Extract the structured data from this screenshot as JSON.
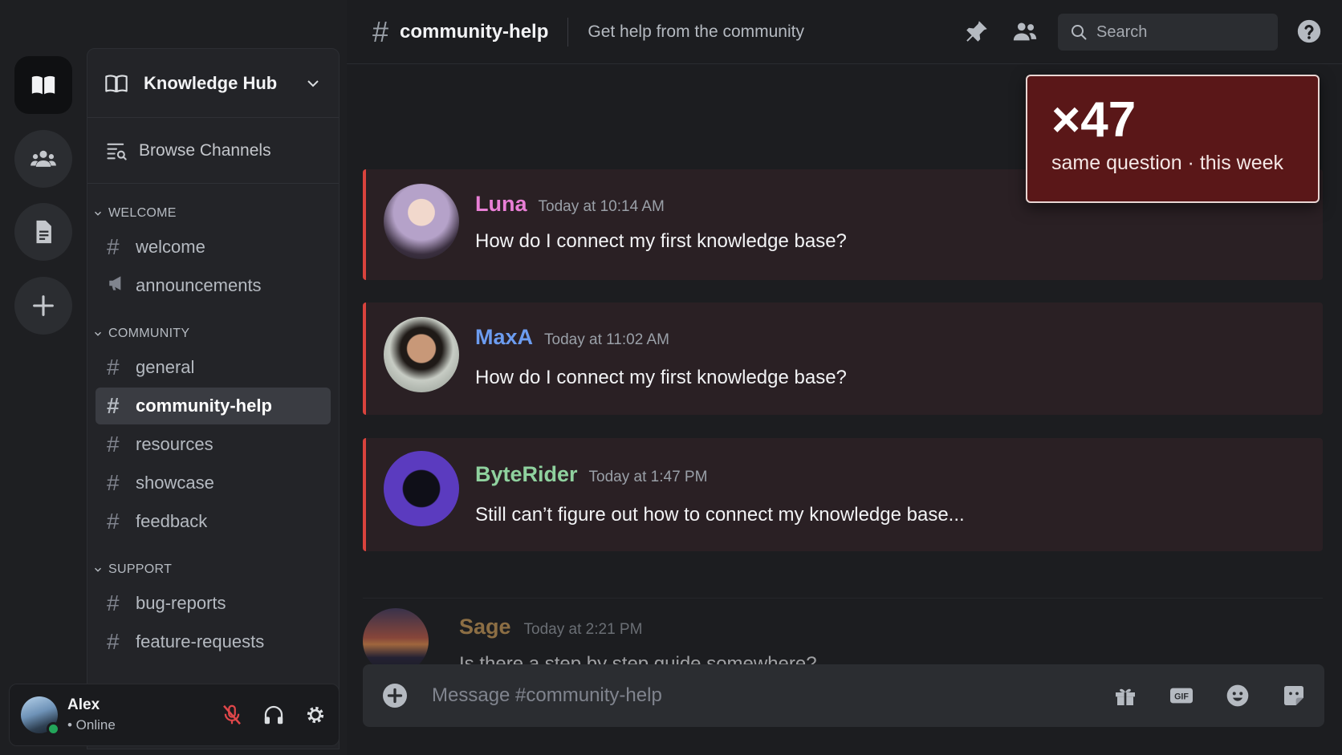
{
  "app": {
    "server_name": "Knowledge Hub",
    "browse_label": "Browse Channels",
    "accent_color": "#d9433d"
  },
  "rail": {
    "items": [
      {
        "name": "knowledge-hub-server",
        "icon": "book-icon",
        "active": true
      },
      {
        "name": "people-server",
        "icon": "people-icon"
      },
      {
        "name": "docs-server",
        "icon": "document-icon"
      },
      {
        "name": "add-server",
        "icon": "plus-icon"
      }
    ]
  },
  "sidebar": {
    "categories": [
      {
        "label": "WELCOME",
        "channels": [
          {
            "label": "welcome",
            "icon": "hash-icon"
          },
          {
            "label": "announcements",
            "icon": "megaphone-icon"
          }
        ]
      },
      {
        "label": "COMMUNITY",
        "channels": [
          {
            "label": "general",
            "icon": "hash-icon"
          },
          {
            "label": "community-help",
            "icon": "hash-icon",
            "active": true
          },
          {
            "label": "resources",
            "icon": "hash-icon"
          },
          {
            "label": "showcase",
            "icon": "hash-icon"
          },
          {
            "label": "feedback",
            "icon": "hash-icon"
          }
        ]
      },
      {
        "label": "SUPPORT",
        "channels": [
          {
            "label": "bug-reports",
            "icon": "hash-icon"
          },
          {
            "label": "feature-requests",
            "icon": "hash-icon"
          }
        ]
      }
    ]
  },
  "user": {
    "name": "Alex",
    "status": "• Online",
    "status_color": "#23a55a"
  },
  "channel": {
    "hash": "#",
    "name": "community-help",
    "topic": "Get help from the community"
  },
  "search": {
    "placeholder": "Search"
  },
  "messages": [
    {
      "author": "Luna",
      "author_color": "#e97fd6",
      "time": "Today at 10:14 AM",
      "text": "How do I connect my first knowledge base?"
    },
    {
      "author": "MaxA",
      "author_color": "#6c9cf0",
      "time": "Today at 11:02 AM",
      "text": "How do I connect my first knowledge base?"
    },
    {
      "author": "ByteRider",
      "author_color": "#8fd19e",
      "time": "Today at 1:47 PM",
      "text": "Still can’t figure out how to connect my knowledge base..."
    },
    {
      "author": "Sage",
      "author_color": "#d1a15a",
      "time": "Today at 2:21 PM",
      "text": "Is there a step by step guide somewhere?"
    }
  ],
  "counter": {
    "count": "×47",
    "caption": "same question · this week"
  },
  "composer": {
    "placeholder": "Message #community-help",
    "gif_label": "GIF"
  }
}
